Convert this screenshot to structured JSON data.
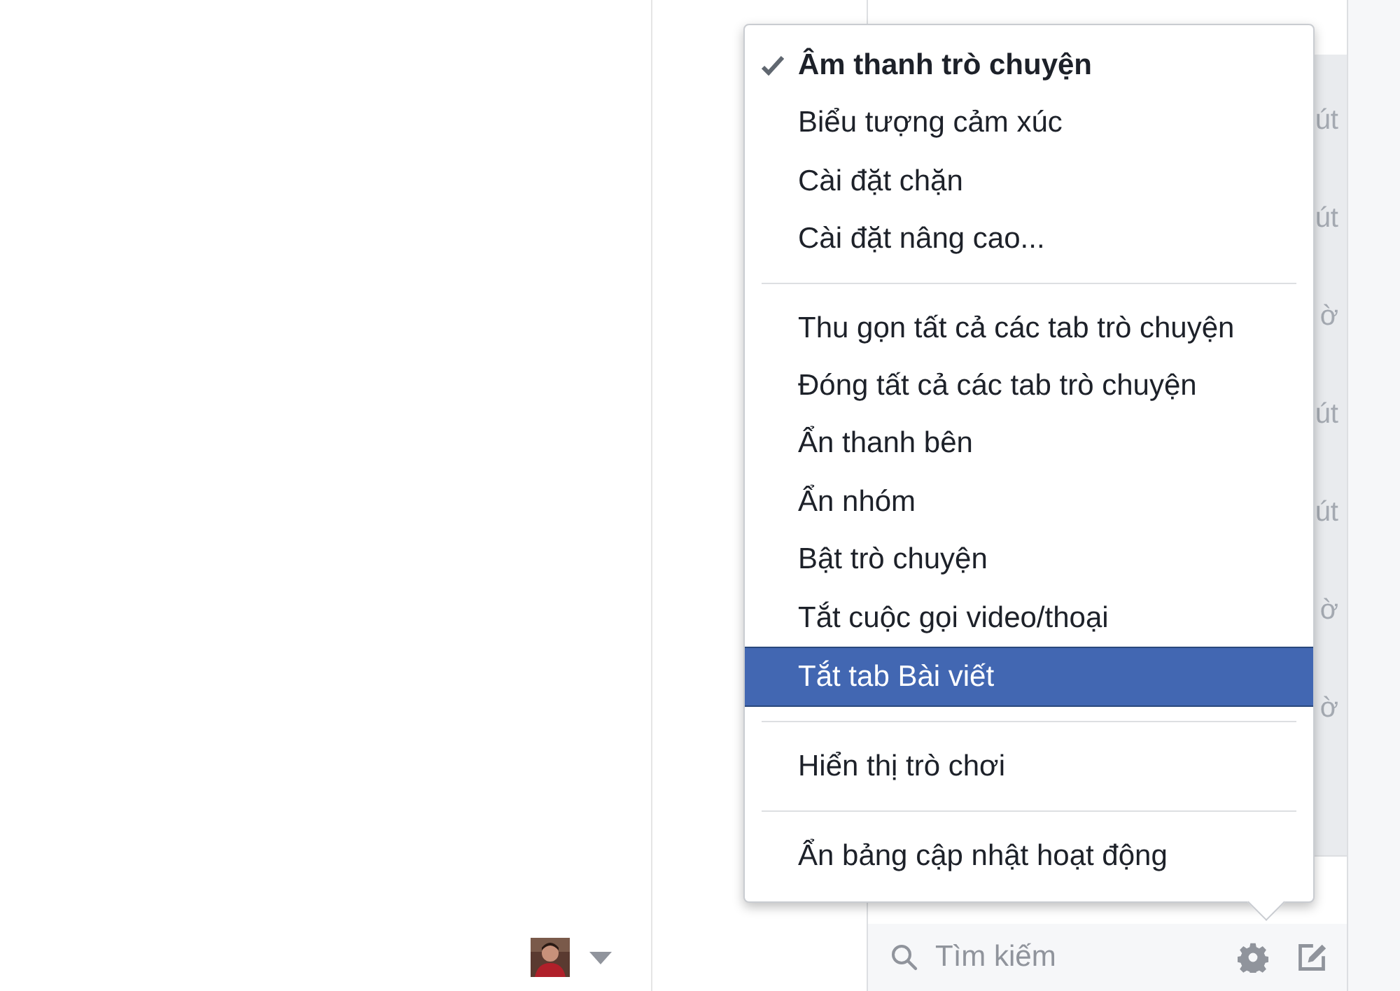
{
  "chat_list": {
    "times": [
      "út",
      "út",
      "ờ",
      "út",
      "út",
      "ờ",
      "ờ"
    ]
  },
  "menu": {
    "sections": [
      {
        "items": [
          {
            "label": "Âm thanh trò chuyện",
            "checked": true,
            "selected": false
          },
          {
            "label": "Biểu tượng cảm xúc",
            "checked": false,
            "selected": false
          },
          {
            "label": "Cài đặt chặn",
            "checked": false,
            "selected": false
          },
          {
            "label": "Cài đặt nâng cao...",
            "checked": false,
            "selected": false
          }
        ]
      },
      {
        "items": [
          {
            "label": "Thu gọn tất cả các tab trò chuyện",
            "checked": false,
            "selected": false
          },
          {
            "label": "Đóng tất cả các tab trò chuyện",
            "checked": false,
            "selected": false
          },
          {
            "label": "Ẩn thanh bên",
            "checked": false,
            "selected": false
          },
          {
            "label": "Ẩn nhóm",
            "checked": false,
            "selected": false
          },
          {
            "label": "Bật trò chuyện",
            "checked": false,
            "selected": false
          },
          {
            "label": "Tắt cuộc gọi video/thoại",
            "checked": false,
            "selected": false
          },
          {
            "label": "Tắt tab Bài viết",
            "checked": false,
            "selected": true
          }
        ]
      },
      {
        "items": [
          {
            "label": "Hiển thị trò chơi",
            "checked": false,
            "selected": false
          }
        ]
      },
      {
        "items": [
          {
            "label": "Ẩn bảng cập nhật hoạt động",
            "checked": false,
            "selected": false
          }
        ]
      }
    ]
  },
  "search": {
    "placeholder": "Tìm kiếm"
  }
}
